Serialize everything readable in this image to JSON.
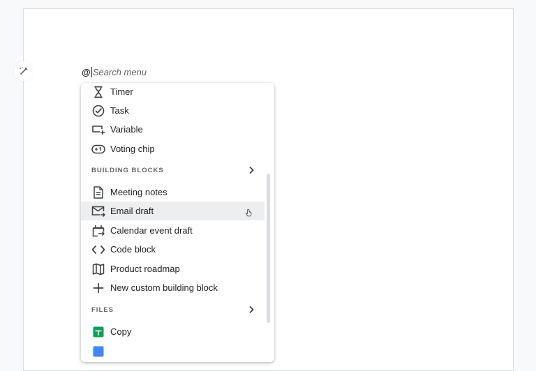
{
  "editor": {
    "at_symbol": "@",
    "search_placeholder": "Search menu"
  },
  "menu": {
    "items_top": [
      {
        "label": "Timer",
        "icon": "hourglass-icon"
      },
      {
        "label": "Task",
        "icon": "check-circle-icon"
      },
      {
        "label": "Variable",
        "icon": "variable-icon"
      },
      {
        "label": "Voting chip",
        "icon": "voting-chip-icon"
      }
    ],
    "building_blocks": {
      "header": "BUILDING BLOCKS",
      "items": [
        {
          "label": "Meeting notes",
          "icon": "document-icon"
        },
        {
          "label": "Email draft",
          "icon": "email-forward-icon"
        },
        {
          "label": "Calendar event draft",
          "icon": "calendar-event-icon"
        },
        {
          "label": "Code block",
          "icon": "code-icon"
        },
        {
          "label": "Product roadmap",
          "icon": "map-icon"
        },
        {
          "label": "New custom building block",
          "icon": "plus-icon"
        }
      ]
    },
    "files": {
      "header": "FILES",
      "items": [
        {
          "label": "Copy",
          "icon": "google-sheets-icon"
        }
      ]
    }
  },
  "colors": {
    "hover_bg": "#edeeef",
    "sheets_green": "#0f9d58",
    "docs_blue": "#4285f4"
  }
}
